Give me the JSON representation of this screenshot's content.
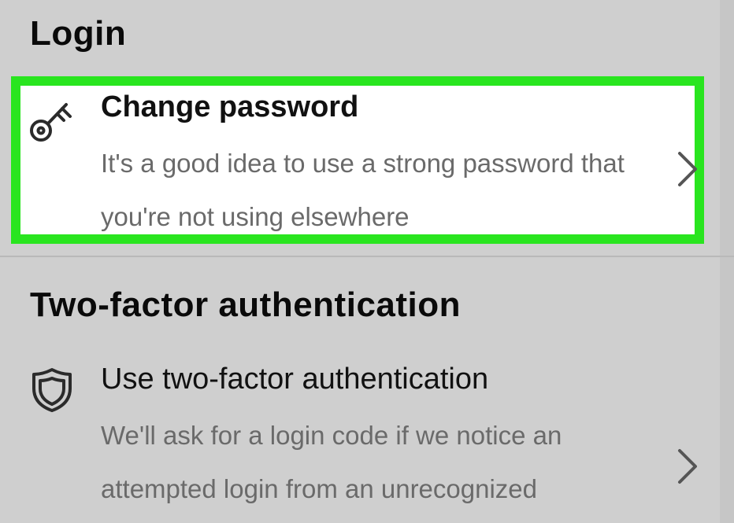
{
  "login": {
    "section_title": "Login",
    "change_password": {
      "title": "Change password",
      "description": "It's a good idea to use a strong password that you're not using elsewhere",
      "icon": "key-icon",
      "highlight_color": "#29e51f"
    }
  },
  "two_factor": {
    "section_title": "Two-factor authentication",
    "use_2fa": {
      "title": "Use two-factor authentication",
      "description": "We'll ask for a login code if we notice an attempted login from an unrecognized",
      "icon": "shield-icon"
    }
  },
  "navigation": {
    "chevron_icon": "chevron-right-icon"
  }
}
